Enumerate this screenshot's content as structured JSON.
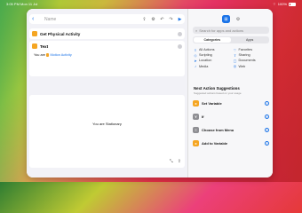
{
  "status_bar": {
    "time": "3:05 PM",
    "date": "Mon 11 Jul",
    "battery": "100%"
  },
  "editor": {
    "toolbar": {
      "back_icon": "chevron-left-icon",
      "title_placeholder": "Name",
      "icons": [
        "share-icon",
        "settings-icon",
        "undo-icon",
        "redo-icon",
        "play-icon"
      ]
    },
    "actions": [
      {
        "label": "Get Physical Activity",
        "icon": "activity-icon"
      },
      {
        "label": "Text",
        "icon": "text-icon",
        "body_prefix": "You are",
        "variable": "Motion Activity"
      }
    ],
    "output": {
      "text": "You are Stationary",
      "icons": [
        "expand-icon",
        "share-icon"
      ]
    }
  },
  "sidebar": {
    "tabs": [
      "actions-tab-icon",
      "info-tab-icon"
    ],
    "search_placeholder": "Search for apps and actions",
    "segments": [
      "Categories",
      "Apps"
    ],
    "active_segment": 0,
    "categories": [
      {
        "label": "All Actions",
        "icon": "list-icon"
      },
      {
        "label": "Favorites",
        "icon": "heart-icon"
      },
      {
        "label": "Scripting",
        "icon": "scripting-icon"
      },
      {
        "label": "Sharing",
        "icon": "share-icon"
      },
      {
        "label": "Location",
        "icon": "location-icon"
      },
      {
        "label": "Documents",
        "icon": "document-icon"
      },
      {
        "label": "Media",
        "icon": "music-icon"
      },
      {
        "label": "Web",
        "icon": "compass-icon"
      }
    ],
    "next_title": "Next Action Suggestions",
    "next_subtitle": "Suggested actions based on your usage",
    "suggestions": [
      {
        "label": "Set Variable",
        "icon": "x-icon",
        "gray": false
      },
      {
        "label": "If",
        "icon": "branch-icon",
        "gray": true
      },
      {
        "label": "Choose from Menu",
        "icon": "menu-icon",
        "gray": true
      },
      {
        "label": "Add to Variable",
        "icon": "x-icon",
        "gray": false
      }
    ]
  },
  "colors": {
    "accent": "#1a73e8",
    "badge": "#f5a623"
  }
}
